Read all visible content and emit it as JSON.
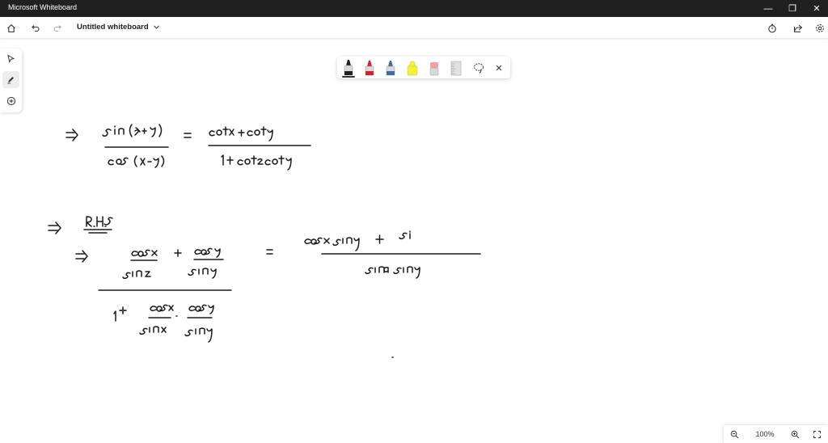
{
  "window": {
    "title": "Microsoft Whiteboard",
    "minimize_glyph": "—",
    "restore_glyph": "❐",
    "close_glyph": "✕"
  },
  "toolbar": {
    "board_name": "Untitled whiteboard",
    "icons": [
      "home-icon",
      "undo-icon",
      "redo-icon",
      "chevron-down-icon",
      "timer-icon",
      "share-icon",
      "settings-icon"
    ]
  },
  "left_rail": {
    "icons": [
      "select-icon",
      "inking-icon",
      "add-icon"
    ],
    "active": "inking-icon"
  },
  "ink_toolbar": {
    "pens": [
      {
        "name": "black-pen",
        "color": "#222222",
        "selected": true
      },
      {
        "name": "red-pen",
        "color": "#d6202e",
        "selected": false
      },
      {
        "name": "blue-pen",
        "color": "#3a6ea5",
        "selected": false
      },
      {
        "name": "yellow-highlighter",
        "color": "#f5f13a",
        "selected": false
      },
      {
        "name": "eraser",
        "color": "#f2a0a8",
        "selected": false
      },
      {
        "name": "ruler",
        "color": "#b8b8b8",
        "selected": false
      }
    ],
    "lasso_icon": "lasso-icon",
    "close_glyph": "✕"
  },
  "zoom": {
    "level": "100%",
    "zoom_out_icon": "zoom-out-icon",
    "zoom_in_icon": "zoom-in-icon"
  },
  "canvas": {
    "handwriting": [
      "⇒ sin(x+y) / cos(x-y) = cotx + coty / 1+ cotx coty",
      "⇒ R.H.S",
      "⇒ (cosx/sinx + cosy/siny) / (1+ cosx/sinx · cosy/siny) = cosx siny + si / sinx siny"
    ]
  }
}
